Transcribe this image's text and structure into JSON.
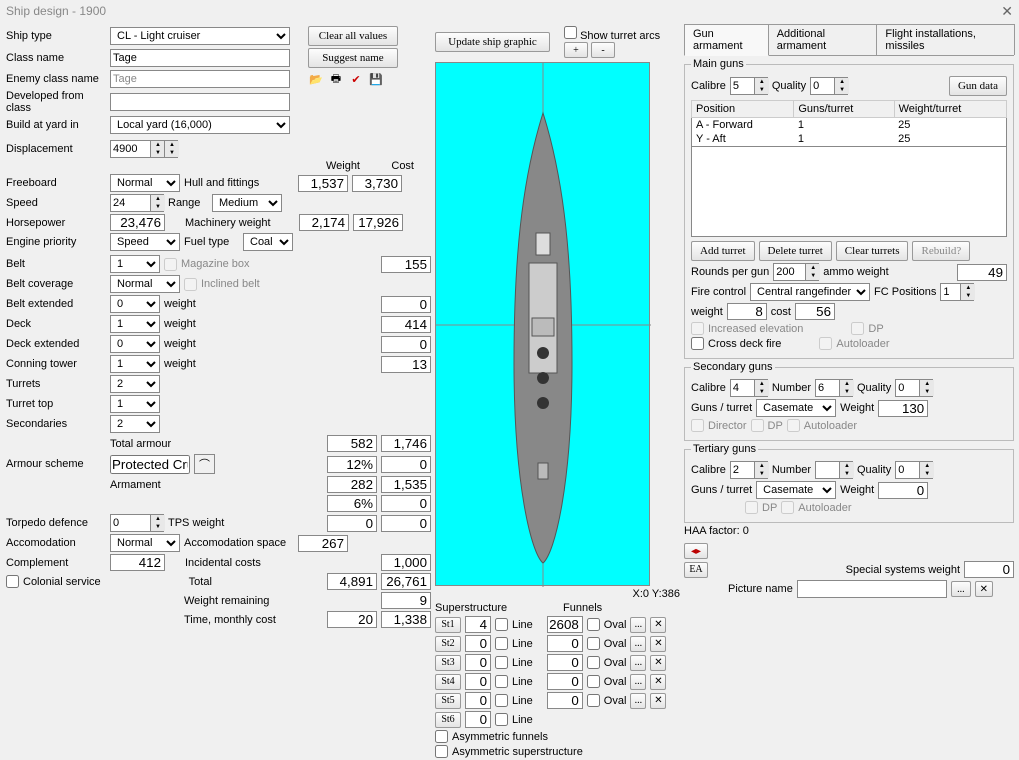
{
  "title": "Ship design - 1900",
  "left": {
    "ship_type_label": "Ship type",
    "ship_type_value": "CL - Light cruiser",
    "class_name_label": "Class name",
    "class_name_value": "Tage",
    "enemy_class_label": "Enemy class name",
    "enemy_class_value": "Tage",
    "developed_label": "Developed from class",
    "developed_value": "",
    "build_yard_label": "Build at yard in",
    "build_yard_value": "Local yard (16,000)",
    "displacement_label": "Displacement",
    "displacement_value": "4900",
    "freeboard_label": "Freeboard",
    "freeboard_value": "Normal",
    "hull_fittings_label": "Hull and fittings",
    "speed_label": "Speed",
    "speed_value": "24",
    "range_label": "Range",
    "range_value": "Medium",
    "horsepower_label": "Horsepower",
    "horsepower_value": "23,476",
    "machinery_label": "Machinery weight",
    "engine_priority_label": "Engine priority",
    "engine_priority_value": "Speed",
    "fuel_type_label": "Fuel type",
    "fuel_type_value": "Coal",
    "belt_label": "Belt",
    "belt_value": "1",
    "magazine_label": "Magazine box",
    "belt_cov_label": "Belt coverage",
    "belt_cov_value": "Normal",
    "inclined_label": "Inclined belt",
    "belt_ext_label": "Belt extended",
    "belt_ext_value": "0",
    "deck_label": "Deck",
    "deck_value": "1",
    "deck_ext_label": "Deck extended",
    "deck_ext_value": "0",
    "conning_label": "Conning tower",
    "conning_value": "1",
    "turrets_label": "Turrets",
    "turrets_value": "2",
    "turret_top_label": "Turret top",
    "turret_top_value": "1",
    "secondaries_label": "Secondaries",
    "secondaries_value": "2",
    "weight_col": "Weight",
    "cost_col": "Cost",
    "hull_weight": "1,537",
    "hull_cost": "3,730",
    "mach_weight": "2,174",
    "mach_cost": "17,926",
    "belt_weight": "155",
    "weight_word": "weight",
    "be_w": "0",
    "dk_w": "414",
    "de_w": "0",
    "ct_w": "13",
    "total_armour_label": "Total armour",
    "ta_w": "582",
    "ta_c": "1,746",
    "armour_scheme_label": "Armour scheme",
    "armour_scheme_value": "Protected Cruiser",
    "pct12": "12%",
    "zero": "0",
    "armament_label": "Armament",
    "arm_w": "282",
    "arm_c": "1,535",
    "pct6": "6%",
    "torpedo_label": "Torpedo defence",
    "torpedo_value": "0",
    "tps_label": "TPS weight",
    "tps_w": "0",
    "tps_c": "0",
    "accom_label": "Accomodation",
    "accom_value": "Normal",
    "accom_space_label": "Accomodation space",
    "accom_space": "267",
    "complement_label": "Complement",
    "complement_value": "412",
    "incidental_label": "Incidental costs",
    "incidental_c": "1,000",
    "colonial_label": "Colonial service",
    "total_label": "Total",
    "total_w": "4,891",
    "total_c": "26,761",
    "weight_rem_label": "Weight remaining",
    "weight_rem": "9",
    "time_label": "Time, monthly cost",
    "time_v": "20",
    "time_c": "1,338"
  },
  "mid": {
    "update_graphic": "Update ship graphic",
    "show_turret_arcs": "Show turret arcs",
    "plus": "+",
    "minus": "-",
    "coords": "X:0 Y:386",
    "superstructure_label": "Superstructure",
    "funnels_label": "Funnels",
    "line_label": "Line",
    "oval_label": "Oval",
    "st": [
      "St1",
      "St2",
      "St3",
      "St4",
      "St5",
      "St6"
    ],
    "st_vals": [
      "4",
      "0",
      "0",
      "0",
      "0",
      "0"
    ],
    "fn_vals": [
      "2608",
      "0",
      "0",
      "0",
      "0"
    ],
    "ellipsis": "...",
    "asym_funnels": "Asymmetric funnels",
    "asym_super": "Asymmetric superstructure"
  },
  "right": {
    "clear_all": "Clear all values",
    "suggest_name": "Suggest name",
    "tabs": [
      "Gun armament",
      "Additional armament",
      "Flight installations, missiles"
    ],
    "main_guns_legend": "Main guns",
    "calibre_label": "Calibre",
    "calibre_value": "5",
    "quality_label": "Quality",
    "quality_value": "0",
    "gun_data_btn": "Gun data",
    "grid_cols": [
      "Position",
      "Guns/turret",
      "Weight/turret"
    ],
    "grid_rows": [
      {
        "pos": "A - Forward",
        "g": "1",
        "w": "25"
      },
      {
        "pos": "Y - Aft",
        "g": "1",
        "w": "25"
      }
    ],
    "add_turret": "Add turret",
    "delete_turret": "Delete turret",
    "clear_turrets": "Clear turrets",
    "rebuild": "Rebuild?",
    "rpg_label": "Rounds per gun",
    "rpg_value": "200",
    "ammo_label": "ammo weight",
    "ammo_value": "49",
    "fc_label": "Fire control",
    "fc_value": "Central rangefinder",
    "fcp_label": "FC Positions",
    "fcp_value": "1",
    "fc_weight_label": "weight",
    "fc_weight": "8",
    "fc_cost_label": "cost",
    "fc_cost": "56",
    "inc_elev": "Increased elevation",
    "dp": "DP",
    "cross": "Cross deck fire",
    "autoloader": "Autoloader",
    "sec_legend": "Secondary guns",
    "number_label": "Number",
    "sec_number": "6",
    "sec_cal": "4",
    "sec_q": "0",
    "gpt_label": "Guns / turret",
    "casemate": "Casemate",
    "weight_label": "Weight",
    "sec_weight": "130",
    "director": "Director",
    "ter_legend": "Tertiary guns",
    "ter_cal": "2",
    "ter_num": "",
    "ter_q": "0",
    "ter_w": "0",
    "haa": "HAA factor: 0",
    "ssw_label": "Special systems weight",
    "ssw_val": "0",
    "ea": "EA",
    "picture_name_label": "Picture name"
  }
}
